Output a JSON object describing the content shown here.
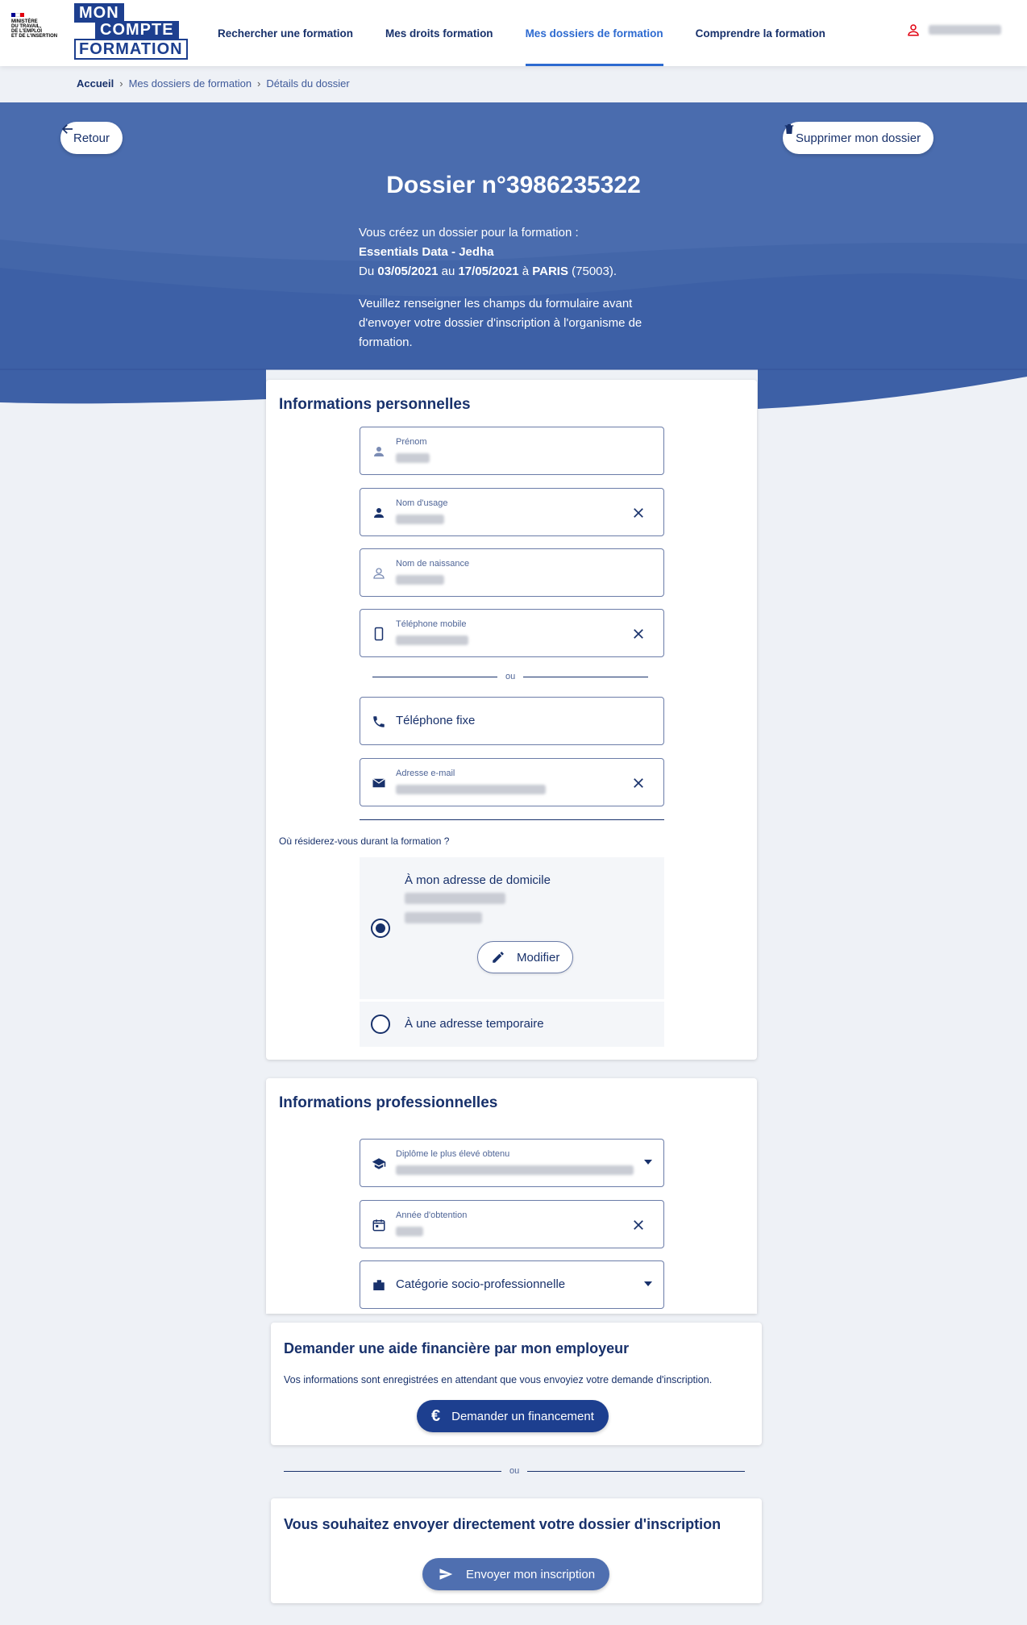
{
  "header": {
    "gov_lines": [
      "MINISTÈRE",
      "DU TRAVAIL,",
      "DE L'EMPLOI",
      "ET DE L'INSERTION"
    ],
    "brand": [
      "MON",
      "COMPTE",
      "FORMATION"
    ],
    "nav": [
      {
        "label": "Rechercher une formation",
        "active": false
      },
      {
        "label": "Mes droits formation",
        "active": false
      },
      {
        "label": "Mes dossiers de formation",
        "active": true
      },
      {
        "label": "Comprendre la formation",
        "active": false
      }
    ]
  },
  "breadcrumb": [
    "Accueil",
    "Mes dossiers de formation",
    "Détails du dossier"
  ],
  "hero": {
    "back_label": "Retour",
    "delete_label": "Supprimer mon dossier",
    "title": "Dossier n°3986235322",
    "intro": "Vous créez un dossier pour la formation :",
    "formation": "Essentials Data - Jedha",
    "du": "Du",
    "date_start": "03/05/2021",
    "au": "au",
    "date_end": "17/05/2021",
    "a": "à",
    "city": "PARIS",
    "postcode": "(75003).",
    "notice": "Veuillez renseigner les champs du formulaire avant d'envoyer votre dossier d'inscription à l'organisme de formation."
  },
  "personal": {
    "title": "Informations personnelles",
    "fields": {
      "prenom": "Prénom",
      "nom_usage": "Nom d'usage",
      "nom_naissance": "Nom de naissance",
      "tel_mobile": "Téléphone mobile",
      "tel_fixe": "Téléphone fixe",
      "email": "Adresse e-mail"
    },
    "or": "ou",
    "residence_question": "Où résiderez-vous durant la formation ?",
    "residence_home": "À mon adresse de domicile",
    "modify_label": "Modifier",
    "residence_temp": "À une adresse temporaire"
  },
  "professional": {
    "title": "Informations professionnelles",
    "diplome": "Diplôme le plus élevé obtenu",
    "annee": "Année d'obtention",
    "categorie": "Catégorie socio-professionnelle"
  },
  "employer": {
    "title": "Demander une aide financière par mon employeur",
    "text": "Vos informations sont enregistrées en attendant que vous envoyiez votre demande d'inscription.",
    "button": "Demander un financement"
  },
  "or2": "ou",
  "send": {
    "title": "Vous souhaitez envoyer directement votre dossier d'inscription",
    "button": "Envoyer mon inscription"
  },
  "colors": {
    "primary": "#1d3f8f",
    "hero": "#4a6eb0",
    "text": "#18316b",
    "link": "#2d6ad0"
  }
}
